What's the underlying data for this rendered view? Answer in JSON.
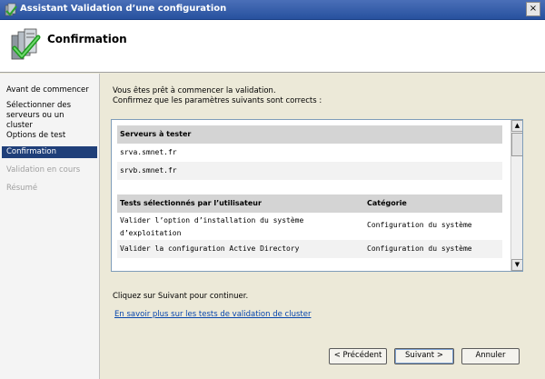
{
  "window": {
    "title": "Assistant Validation d’une configuration",
    "close_label": "×"
  },
  "header": {
    "title": "Confirmation"
  },
  "nav": {
    "items": [
      {
        "label": "Avant de commencer",
        "state": "normal"
      },
      {
        "label": "Sélectionner des serveurs ou un cluster",
        "state": "normal"
      },
      {
        "label": "Options de test",
        "state": "normal"
      },
      {
        "label": "Confirmation",
        "state": "active"
      },
      {
        "label": "Validation en cours",
        "state": "disabled"
      },
      {
        "label": "Résumé",
        "state": "disabled"
      }
    ]
  },
  "main": {
    "intro_line1": "Vous êtes prêt à commencer la validation.",
    "intro_line2": "Confirmez que les paramètres suivants sont corrects :",
    "servers_header": "Serveurs à tester",
    "servers": [
      "srva.smnet.fr",
      "srvb.smnet.fr"
    ],
    "tests_header": "Tests sélectionnés par l’utilisateur",
    "category_header": "Catégorie",
    "tests": [
      {
        "name": "Valider l’option d’installation du système d’exploitation",
        "category": "Configuration du système"
      },
      {
        "name": "Valider la configuration Active Directory",
        "category": "Configuration du système"
      }
    ],
    "continue_text": "Cliquez sur Suivant pour continuer.",
    "help_link": "En savoir plus sur les tests de validation de cluster"
  },
  "buttons": {
    "prev": "< Précédent",
    "next": "Suivant >",
    "cancel": "Annuler"
  },
  "scrollbar": {
    "up": "▲",
    "down": "▼"
  }
}
